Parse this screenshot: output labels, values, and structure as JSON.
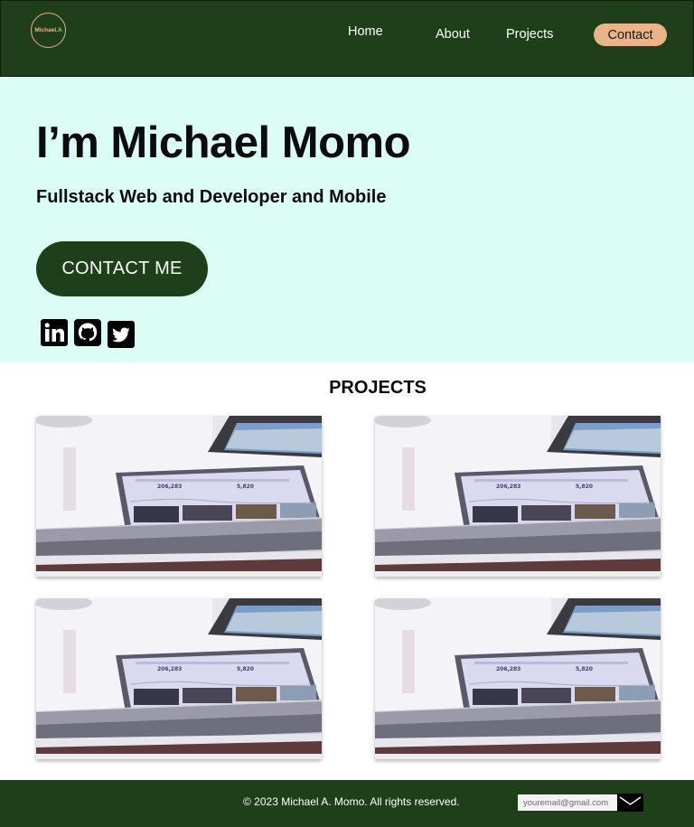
{
  "nav": {
    "logo_text": "Michael.A",
    "links": [
      {
        "label": "Home"
      },
      {
        "label": "About"
      },
      {
        "label": "Projects"
      }
    ],
    "contact_label": "Contact"
  },
  "hero": {
    "title": "I’m Michael Momo",
    "subtitle": "Fullstack Web and Developer and Mobile",
    "cta_label": "CONTACT ME",
    "socials": [
      "linkedin-icon",
      "github-icon",
      "twitter-icon"
    ]
  },
  "projects": {
    "title": "PROJECTS",
    "cards": [
      {
        "screen_value_1": "206,283",
        "screen_value_2": "5,820"
      },
      {
        "screen_value_1": "206,283",
        "screen_value_2": "5,820"
      },
      {
        "screen_value_1": "206,283",
        "screen_value_2": "5,820"
      },
      {
        "screen_value_1": "206,283",
        "screen_value_2": "5,820"
      }
    ]
  },
  "footer": {
    "copyright": "© 2023 Michael A. Momo. All rights reserved.",
    "email_placeholder": "youremail@gmail.com",
    "send_icon": "envelope-icon"
  },
  "colors": {
    "brand_green": "#1e3f1a",
    "accent_peach": "#e9b487",
    "hero_bg": "#dbfdf6"
  }
}
